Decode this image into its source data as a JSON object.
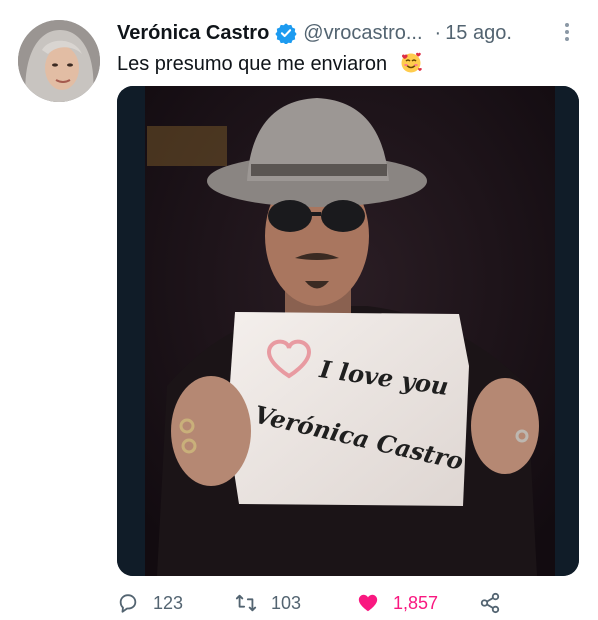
{
  "tweet": {
    "author_name": "Verónica Castro",
    "author_handle": "@vrocastro...",
    "separator": "·",
    "date": "15 ago.",
    "text": "Les presumo que me enviaron",
    "emoji": "smiling-face-with-hearts",
    "verified": true
  },
  "image": {
    "sign_line1": "I love you",
    "sign_line2": "Verónica Castro"
  },
  "actions": {
    "replies": "123",
    "retweets": "103",
    "likes": "1,857",
    "liked": true
  },
  "colors": {
    "verified": "#1d9bf0",
    "like": "#f91880",
    "muted": "#536471"
  }
}
